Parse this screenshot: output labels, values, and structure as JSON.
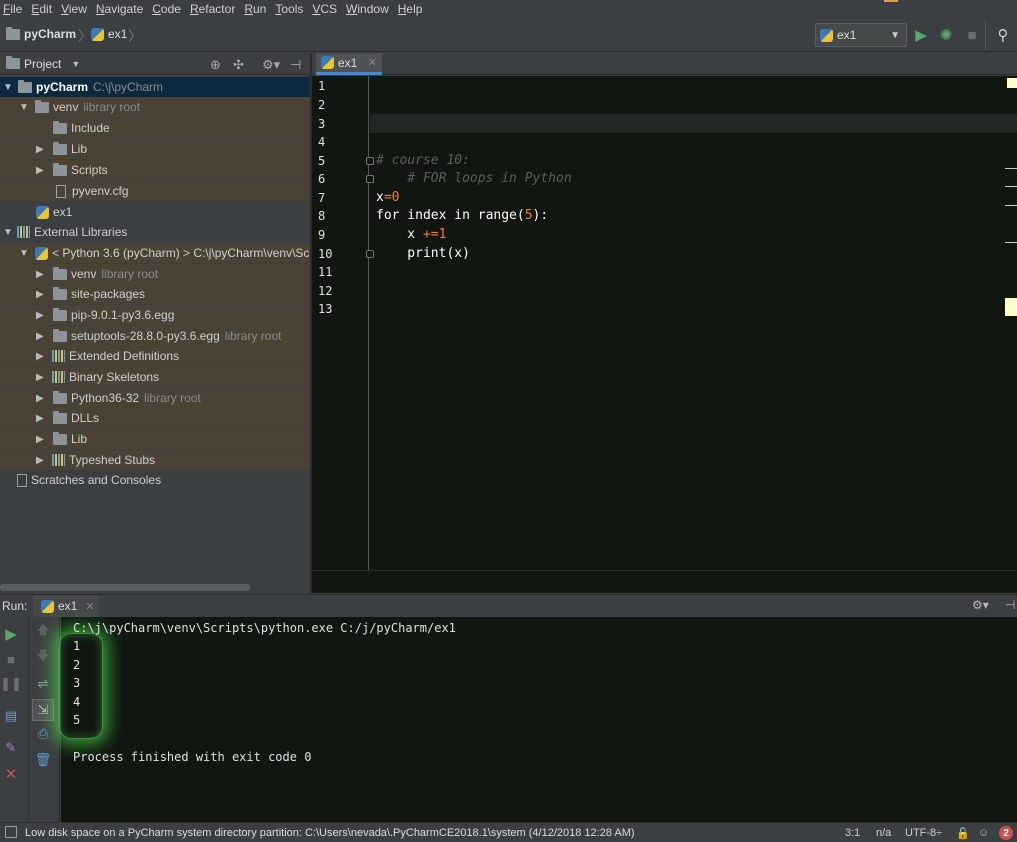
{
  "menu": [
    "File",
    "Edit",
    "View",
    "Navigate",
    "Code",
    "Refactor",
    "Run",
    "Tools",
    "VCS",
    "Window",
    "Help"
  ],
  "breadcrumb": {
    "project": "pyCharm",
    "file": "ex1"
  },
  "run_config": {
    "selected": "ex1"
  },
  "project_panel": {
    "title": "Project"
  },
  "tree": {
    "root": {
      "name": "pyCharm",
      "path": "C:\\j\\pyCharm"
    },
    "venv": {
      "name": "venv",
      "hint": "library root"
    },
    "include": "Include",
    "lib": "Lib",
    "scripts": "Scripts",
    "pyvenv": "pyvenv.cfg",
    "ex1": "ex1",
    "external": "External Libraries",
    "python": "< Python 3.6 (pyCharm) >  C:\\j\\pyCharm\\venv\\Scrip",
    "venv2": {
      "name": "venv",
      "hint": "library root"
    },
    "site_packages": "site-packages",
    "pip": "pip-9.0.1-py3.6.egg",
    "setuptools": {
      "name": "setuptools-28.8.0-py3.6.egg",
      "hint": "library root"
    },
    "extended": "Extended Definitions",
    "binary": "Binary Skeletons",
    "python36": {
      "name": "Python36-32",
      "hint": "library root"
    },
    "dlls": "DLLs",
    "lib2": "Lib",
    "typeshed": "Typeshed Stubs",
    "scratches": "Scratches and Consoles"
  },
  "editor": {
    "tab": "ex1",
    "line_numbers": [
      "1",
      "2",
      "3",
      "4",
      "5",
      "6",
      "7",
      "8",
      "9",
      "10",
      "11",
      "12",
      "13"
    ],
    "code": {
      "l5_comment": "# course 10:",
      "l6_comment": "    # FOR loops in Python",
      "l7_var": "x",
      "l7_op": "=",
      "l7_num": "0",
      "l8_for": "for index in range(",
      "l8_num": "5",
      "l8_end": "):",
      "l9_x": "    x ",
      "l9_op": "+=",
      "l9_num": "1",
      "l10": "    print(x)"
    }
  },
  "run": {
    "label": "Run:",
    "tab": "ex1",
    "console": [
      "C:\\j\\pyCharm\\venv\\Scripts\\python.exe C:/j/pyCharm/ex1",
      "1",
      "2",
      "3",
      "4",
      "5",
      "",
      "Process finished with exit code 0"
    ]
  },
  "status": {
    "message": "Low disk space on a PyCharm system directory partition: C:\\Users\\nevada\\.PyCharmCE2018.1\\system (4/12/2018 12:28 AM)",
    "position": "3:1",
    "line_sep": "n/a",
    "encoding": "UTF-8÷",
    "notifications": "2"
  },
  "colors": {
    "accent": "#4a88c7",
    "run_green": "#59a869",
    "stop_red": "#c75450",
    "library_bg": "#4a4335"
  }
}
